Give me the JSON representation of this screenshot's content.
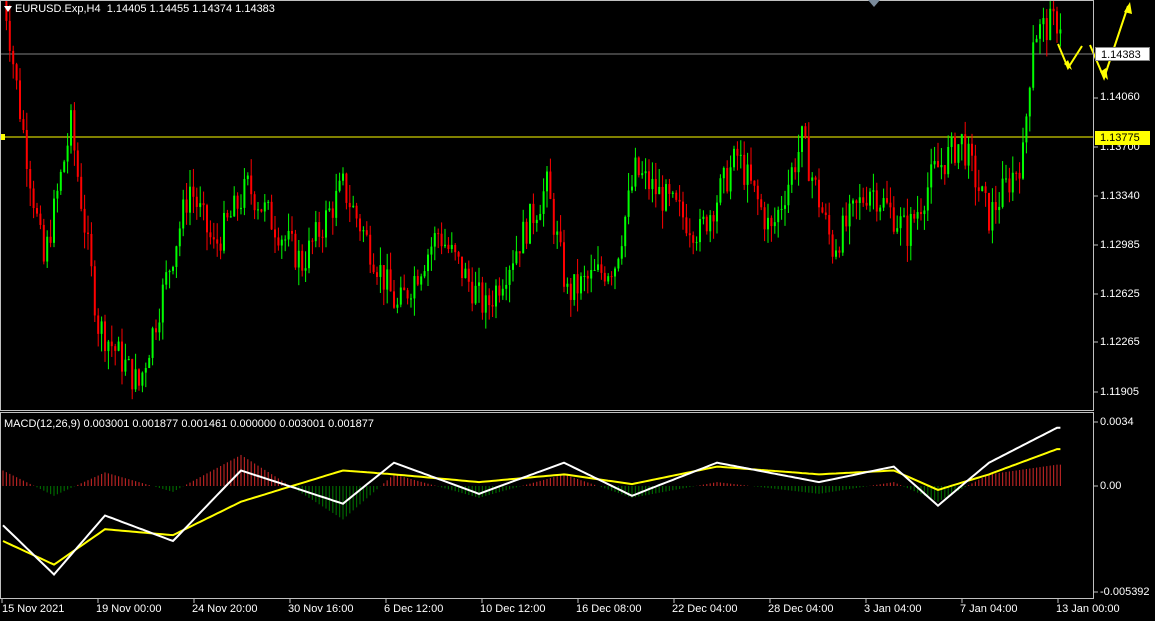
{
  "header": {
    "symbol": "EURUSD.Exp,H4",
    "ohlc": "1.14405 1.14455 1.14374 1.14383"
  },
  "indicator": {
    "label": "MACD(12,26,9) 0.003001 0.001877 0.001461 0.000000 0.003001 0.001877"
  },
  "price_axis": [
    "1.14060",
    "1.13700",
    "1.13340",
    "1.12985",
    "1.12625",
    "1.12265",
    "1.11905"
  ],
  "macd_axis": [
    "0.0034",
    "0.00",
    "-0.005392"
  ],
  "bid_tag": "1.14383",
  "level_tag": "1.13775",
  "time_axis": [
    "15 Nov 2021",
    "19 Nov 00:00",
    "24 Nov 20:00",
    "30 Nov 16:00",
    "6 Dec 12:00",
    "10 Dec 12:00",
    "16 Dec 08:00",
    "22 Dec 04:00",
    "28 Dec 04:00",
    "3 Jan 04:00",
    "7 Jan 04:00",
    "13 Jan 00:00"
  ],
  "colors": {
    "background": "#000000",
    "bull": "#00ff00",
    "bear": "#ff0000",
    "grid": "#808080",
    "level": "#ffff00",
    "macd_line": "#ffffff",
    "signal_line": "#ffff00",
    "hist_pos": "#b22222",
    "hist_neg": "#006400"
  },
  "chart_data": {
    "type": "candlestick",
    "price_keypoints": [
      [
        0,
        1.146
      ],
      [
        5,
        1.138
      ],
      [
        12,
        1.128
      ],
      [
        20,
        1.137
      ],
      [
        28,
        1.124
      ],
      [
        40,
        1.12
      ],
      [
        55,
        1.133
      ],
      [
        62,
        1.129
      ],
      [
        72,
        1.133
      ],
      [
        88,
        1.128
      ],
      [
        100,
        1.133
      ],
      [
        116,
        1.125
      ],
      [
        128,
        1.13
      ],
      [
        142,
        1.125
      ],
      [
        160,
        1.133
      ],
      [
        166,
        1.126
      ],
      [
        180,
        1.128
      ],
      [
        186,
        1.134
      ],
      [
        205,
        1.13
      ],
      [
        216,
        1.135
      ],
      [
        226,
        1.13
      ],
      [
        235,
        1.136
      ],
      [
        244,
        1.129
      ],
      [
        255,
        1.133
      ],
      [
        266,
        1.13
      ],
      [
        274,
        1.134
      ],
      [
        282,
        1.136
      ],
      [
        290,
        1.131
      ],
      [
        300,
        1.135
      ],
      [
        303,
        1.143
      ],
      [
        310,
        1.1438
      ]
    ],
    "macd_keypoints": [
      [
        0,
        -0.002
      ],
      [
        15,
        -0.0045
      ],
      [
        30,
        -0.0015
      ],
      [
        50,
        -0.0028
      ],
      [
        70,
        0.0008
      ],
      [
        100,
        -0.0009
      ],
      [
        115,
        0.0012
      ],
      [
        140,
        -0.0004
      ],
      [
        165,
        0.0012
      ],
      [
        185,
        -0.0005
      ],
      [
        210,
        0.0012
      ],
      [
        240,
        0.0002
      ],
      [
        262,
        0.001
      ],
      [
        275,
        -0.001
      ],
      [
        290,
        0.0012
      ],
      [
        310,
        0.003
      ]
    ],
    "signal_keypoints": [
      [
        0,
        -0.0028
      ],
      [
        15,
        -0.004
      ],
      [
        30,
        -0.0022
      ],
      [
        50,
        -0.0025
      ],
      [
        70,
        -0.0008
      ],
      [
        100,
        0.0008
      ],
      [
        115,
        0.0006
      ],
      [
        140,
        0.0002
      ],
      [
        165,
        0.0006
      ],
      [
        185,
        0.0001
      ],
      [
        210,
        0.001
      ],
      [
        240,
        0.0006
      ],
      [
        262,
        0.0008
      ],
      [
        275,
        -0.0002
      ],
      [
        290,
        0.0006
      ],
      [
        310,
        0.0019
      ]
    ],
    "ylim": [
      1.11905,
      1.14455
    ],
    "macd_ylim": [
      -0.005392,
      0.0034
    ]
  }
}
